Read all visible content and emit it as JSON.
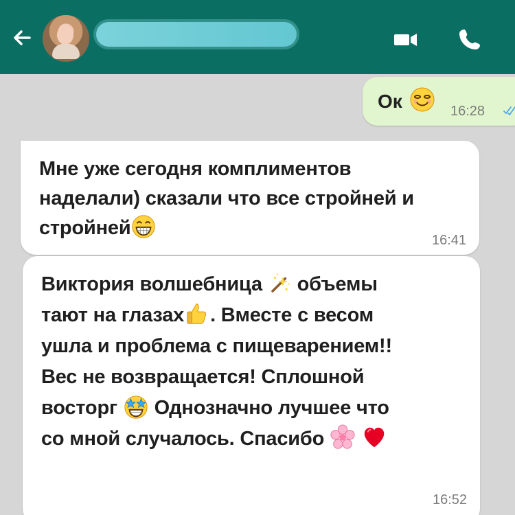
{
  "header": {
    "contact_name": "",
    "back_icon": "arrow-left-icon",
    "video_icon": "video-camera-icon",
    "call_icon": "phone-icon"
  },
  "messages": [
    {
      "direction": "outgoing",
      "text": "Ок",
      "emoji": "smiling-face-icon",
      "time": "16:28",
      "status_icon": "double-check-icon"
    },
    {
      "direction": "incoming",
      "lines": [
        "Мне уже сегодня комплиментов",
        "наделали) сказали что все стройней и",
        "стройней"
      ],
      "emoji": "grinning-face-icon",
      "time": "16:41"
    },
    {
      "direction": "incoming",
      "segments": [
        "Виктория волшебница",
        "объемы",
        "тают на глазах",
        ". Вместе с весом",
        "ушла и проблема с пищеварением!!",
        "Вес не возвращается! Сплошной",
        "восторг",
        "Однозначно лучшее что",
        "со мной случалось. Спасибо"
      ],
      "emojis": [
        "magic-wand-icon",
        "thumbs-up-icon",
        "star-struck-icon",
        "cherry-blossom-icon",
        "heart-icon"
      ],
      "time": "16:52"
    }
  ],
  "colors": {
    "header": "#0b6e62",
    "chat_background": "#d7d6d6",
    "outgoing_bubble": "#e1f6cf",
    "incoming_bubble": "#ffffff",
    "timestamp": "#7b7b7b"
  }
}
